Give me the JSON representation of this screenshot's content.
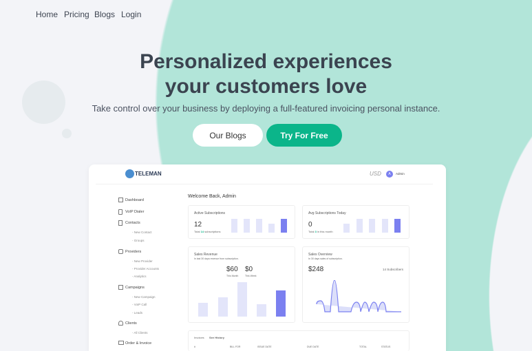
{
  "nav": [
    "Home",
    "Pricing",
    "Blogs",
    "Login"
  ],
  "hero": {
    "title": "Personalized experiences your customers love",
    "subtitle": "Take control over your business by deploying a full-featured invoicing personal instance.",
    "btn_blogs": "Our Blogs",
    "btn_try": "Try For Free"
  },
  "colors": {
    "accent": "#0bb58a",
    "blob": "#b2e5d9",
    "chart": "#7b80f0"
  },
  "dashboard": {
    "logo": "TELEMAN",
    "currency": "USD",
    "avatar": "A",
    "user": "Admin",
    "welcome": "Welcome Back, Admin",
    "sidebar": [
      {
        "label": "Dashboard",
        "icon": "grid-icon"
      },
      {
        "label": "VoIP Dialer",
        "icon": "phone-icon"
      },
      {
        "label": "Contacts",
        "icon": "book-icon"
      },
      {
        "sub": "- New Contact"
      },
      {
        "sub": "- Groups"
      },
      {
        "label": "Providers",
        "icon": "phone-call-icon"
      },
      {
        "sub": "- New Provider"
      },
      {
        "sub": "- Provider Accounts"
      },
      {
        "sub": "- Analytics"
      },
      {
        "label": "Campaigns",
        "icon": "columns-icon"
      },
      {
        "sub": "- New Campaign"
      },
      {
        "sub": "- VoIP Call"
      },
      {
        "sub": "- Leads"
      },
      {
        "label": "Clients",
        "icon": "users-icon"
      },
      {
        "sub": "- All Clients"
      },
      {
        "label": "Order & Invoice",
        "icon": "invoice-icon"
      }
    ],
    "active": {
      "title": "Active Subscriptions",
      "value": "12",
      "note_pre": "Total",
      "note_num": "14",
      "note_post": "subscriptions"
    },
    "avg": {
      "title": "Avg Subscriptions Today",
      "value": "0",
      "note_pre": "Total",
      "note_num": "3",
      "note_post": "in this month"
    },
    "revenue": {
      "title": "Sales Revenue",
      "subtitle": "In last 30 days revenue from subscription.",
      "month": "$60",
      "month_label": "This Month",
      "week": "$0",
      "week_label": "This Week"
    },
    "overview": {
      "title": "Sales Overview",
      "subtitle": "In 30 days sales of subscription.",
      "value": "$248",
      "subs": "14 Subscribers"
    },
    "invoices": {
      "tab1": "Invoices",
      "tab2": "See History",
      "cols": [
        "#",
        "BILL FOR",
        "ISSUE DATE",
        "DUE DATE",
        "TOTAL",
        "STATUS"
      ]
    }
  }
}
